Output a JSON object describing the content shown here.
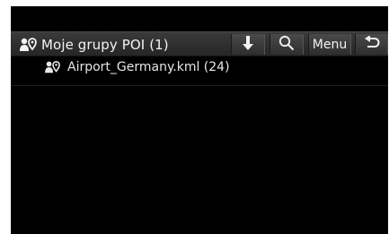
{
  "header": {
    "title": "Moje grupy POI (1)",
    "title_icon": "poi-group-icon",
    "buttons": {
      "download_icon": "download-arrow-icon",
      "search_icon": "search-icon",
      "menu_label": "Menu",
      "back_icon": "back-arrow-icon"
    }
  },
  "list": {
    "items": [
      {
        "label": "Airport_Germany.kml (24)",
        "icon": "poi-group-icon"
      }
    ]
  },
  "colors": {
    "background": "#000000",
    "header": "#2e2e2e",
    "text": "#f2f2f2"
  }
}
